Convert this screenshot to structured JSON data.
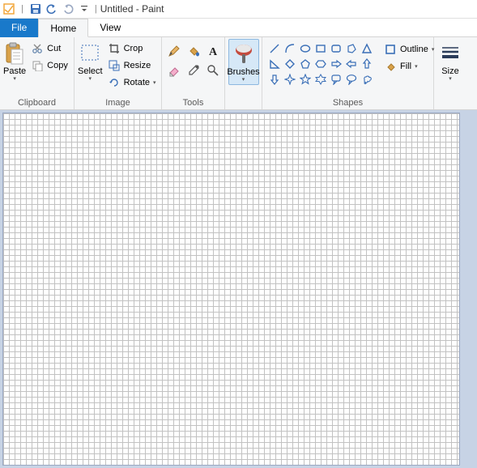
{
  "title": {
    "document": "Untitled",
    "app": "Paint",
    "sep": "-"
  },
  "tabs": {
    "file": "File",
    "home": "Home",
    "view": "View"
  },
  "clipboard": {
    "group_label": "Clipboard",
    "paste": "Paste",
    "cut": "Cut",
    "copy": "Copy"
  },
  "image": {
    "group_label": "Image",
    "select": "Select",
    "crop": "Crop",
    "resize": "Resize",
    "rotate": "Rotate"
  },
  "tools": {
    "group_label": "Tools"
  },
  "brushes": {
    "label": "Brushes"
  },
  "shapes": {
    "group_label": "Shapes",
    "outline": "Outline",
    "fill": "Fill"
  },
  "size": {
    "label": "Size"
  }
}
